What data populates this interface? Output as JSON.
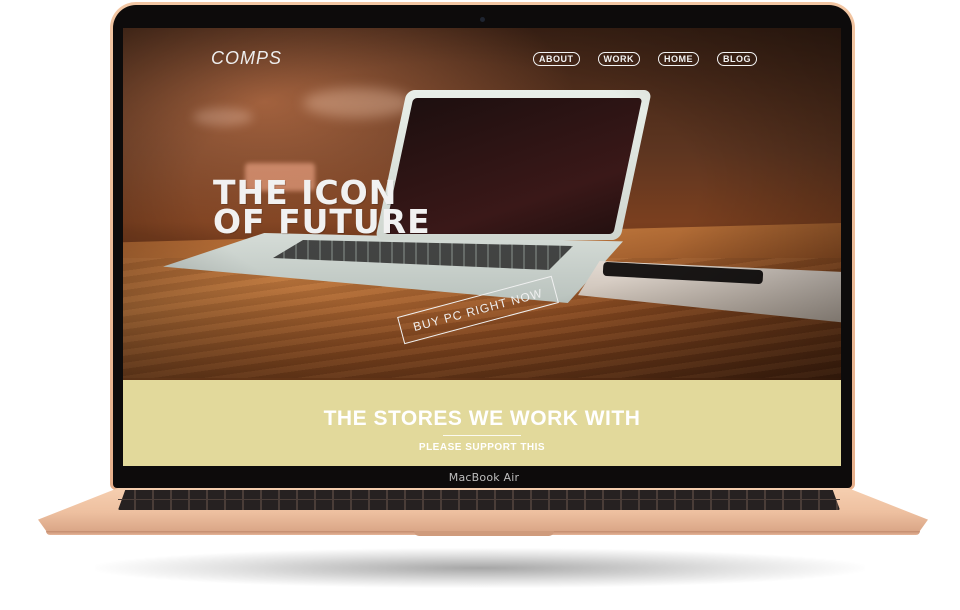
{
  "site": {
    "logo": "COMPS",
    "nav": [
      "ABOUT",
      "WORK",
      "HOME",
      "BLOG"
    ]
  },
  "hero": {
    "title": "THE ICON\nOF FUTURE",
    "cta_label": "BUY PC RIGHT NOW"
  },
  "stores": {
    "title": "THE STORES WE WORK WITH",
    "subtitle": "PLEASE SUPPORT THIS"
  },
  "device": {
    "model_label": "MacBook Air"
  },
  "colors": {
    "stores_band": "#e2d99b",
    "device_body": "#efc3a2"
  }
}
